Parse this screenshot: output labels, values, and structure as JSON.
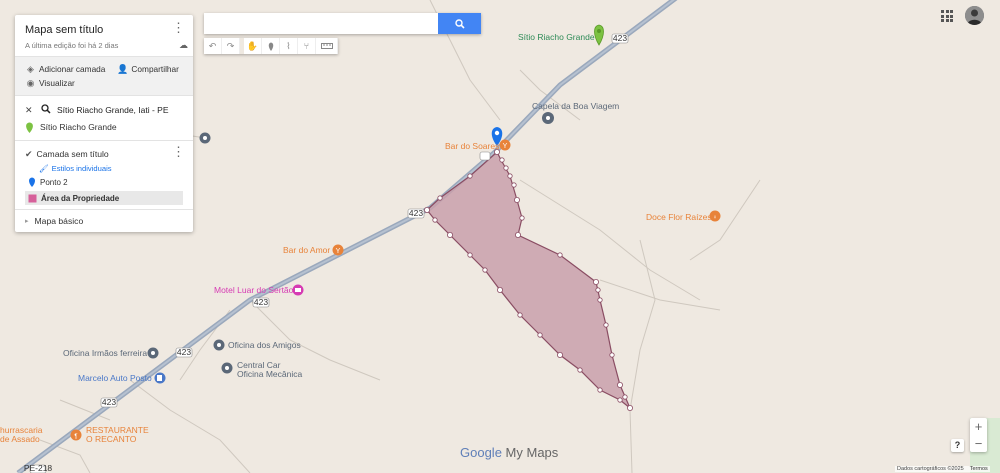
{
  "map_title": "Mapa sem título",
  "last_edit": "A última edição foi há 2 dias",
  "actions": {
    "add_layer": "Adicionar camada",
    "share": "Compartilhar",
    "preview": "Visualizar"
  },
  "search_result": {
    "query": "Sítio Riacho Grande, Iati - PE",
    "place": "Sítio Riacho Grande"
  },
  "layer": {
    "name": "Camada sem título",
    "styles_link": "Estilos individuais",
    "features": [
      "Ponto 2",
      "Área da Propriedade"
    ]
  },
  "basemap_label": "Mapa básico",
  "search_box": {
    "value": "",
    "placeholder": ""
  },
  "map_labels": {
    "sitio": "Sítio Riacho Grande",
    "capela": "Capela da Boa Viagem",
    "bar_soares": "Bar do Soares",
    "doce_flor": "Doce Flor Raízes",
    "bar_amor": "Bar do Amor",
    "motel": "Motel Luar do Sertão",
    "oficina_amigos": "Oficina dos Amigos",
    "oficina_irmaos": "Oficina Irmãos ferreira",
    "central_car_1": "Central Car",
    "central_car_2": "Oficina Mecânica",
    "marcelo": "Marcelo Auto Posto",
    "churrascaria_1": "hurrascaria",
    "churrascaria_2": "de Assado",
    "restaurante_1": "RESTAURANTE",
    "restaurante_2": "O RECANTO",
    "road_423": "423",
    "road_small": "PE-218"
  },
  "logo": {
    "google": "Google",
    "my_maps": "My Maps"
  },
  "attribution": "Dados cartográficos ©2025",
  "terms": "Termos",
  "zoom": {
    "in": "+",
    "out": "−"
  },
  "help": "?",
  "colors": {
    "accent": "#4285f4",
    "polygon_fill": "#c9a0ab",
    "polygon_stroke": "#8a4d63",
    "road": "#9aa8bc",
    "pin_green": "#7cc242",
    "pin_blue": "#1a73e8",
    "poi_orange": "#e8833a",
    "poi_pink": "#d63bb3",
    "poi_gray": "#5b6878"
  }
}
